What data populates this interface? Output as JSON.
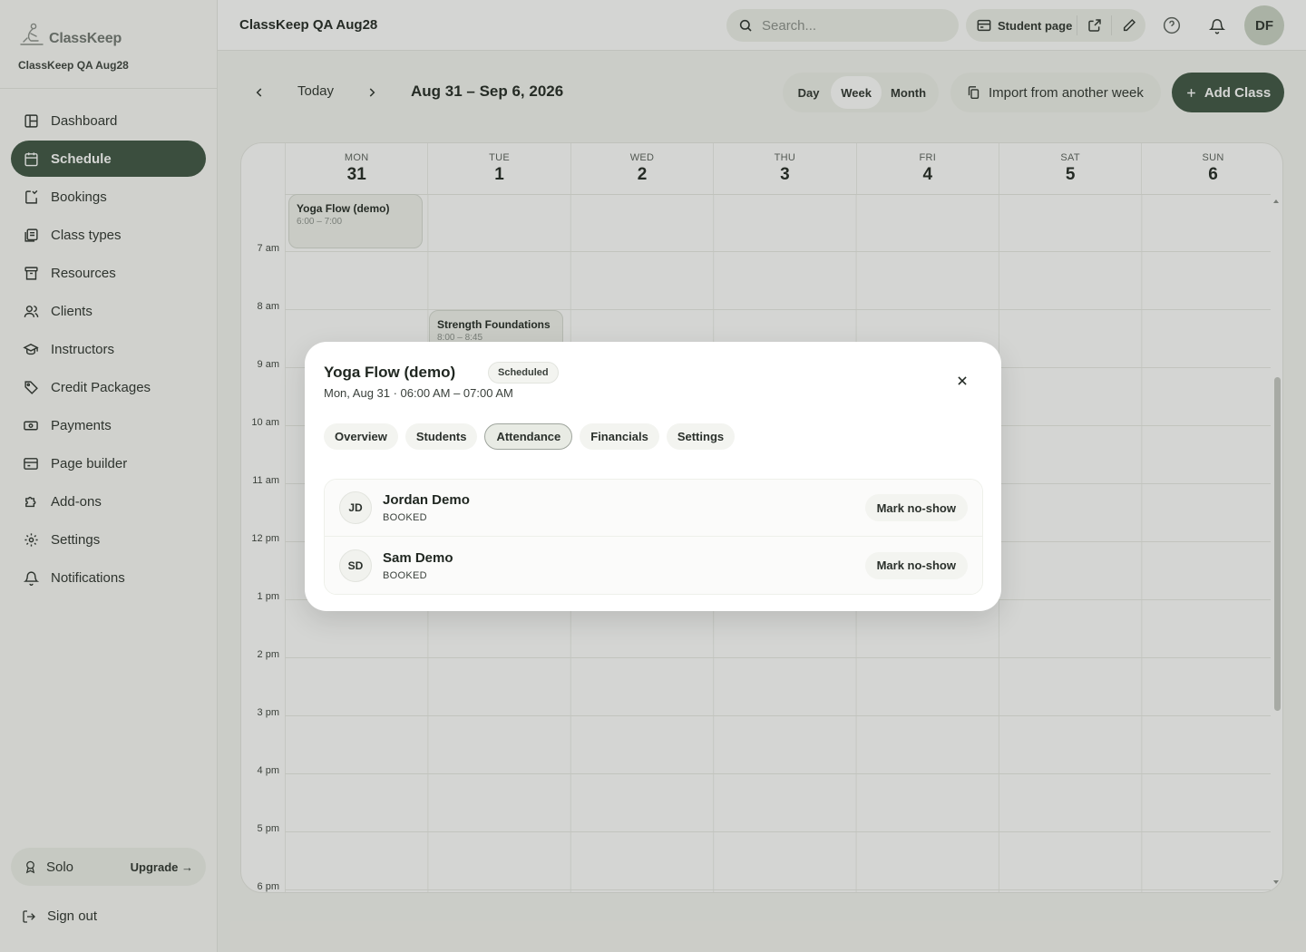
{
  "sidebar": {
    "brand": "ClassKeep",
    "studio": "ClassKeep QA Aug28",
    "items": [
      {
        "label": "Dashboard",
        "icon": "dashboard-icon"
      },
      {
        "label": "Schedule",
        "icon": "calendar-icon",
        "active": true
      },
      {
        "label": "Bookings",
        "icon": "bookings-icon"
      },
      {
        "label": "Class types",
        "icon": "class-types-icon"
      },
      {
        "label": "Resources",
        "icon": "archive-icon"
      },
      {
        "label": "Clients",
        "icon": "users-icon"
      },
      {
        "label": "Instructors",
        "icon": "graduation-cap-icon"
      },
      {
        "label": "Credit Packages",
        "icon": "tag-icon"
      },
      {
        "label": "Payments",
        "icon": "banknote-icon"
      },
      {
        "label": "Page builder",
        "icon": "layout-icon"
      },
      {
        "label": "Add-ons",
        "icon": "puzzle-icon"
      },
      {
        "label": "Settings",
        "icon": "gear-icon"
      },
      {
        "label": "Notifications",
        "icon": "bell-icon"
      }
    ],
    "plan": {
      "name": "Solo",
      "upgrade": "Upgrade →"
    },
    "signout": "Sign out"
  },
  "topbar": {
    "title": "ClassKeep QA Aug28",
    "search_placeholder": "Search...",
    "student_page": "Student page",
    "avatar": "DF"
  },
  "toolbar": {
    "today": "Today",
    "range": "Aug 31 – Sep 6, 2026",
    "views": [
      {
        "label": "Day"
      },
      {
        "label": "Week",
        "active": true
      },
      {
        "label": "Month"
      }
    ],
    "import": "Import from another week",
    "add": "Add Class"
  },
  "calendar": {
    "days": [
      {
        "name": "MON",
        "num": "31"
      },
      {
        "name": "TUE",
        "num": "1"
      },
      {
        "name": "WED",
        "num": "2"
      },
      {
        "name": "THU",
        "num": "3"
      },
      {
        "name": "FRI",
        "num": "4"
      },
      {
        "name": "SAT",
        "num": "5"
      },
      {
        "name": "SUN",
        "num": "6"
      }
    ],
    "hours": [
      "7 am",
      "8 am",
      "9 am",
      "10 am",
      "11 am",
      "12 pm",
      "1 pm",
      "2 pm",
      "3 pm",
      "4 pm",
      "5 pm",
      "6 pm"
    ],
    "events": [
      {
        "title": "Yoga Flow (demo)",
        "time": "6:00 – 7:00",
        "day": "MON"
      },
      {
        "title": "Strength Foundations",
        "time": "8:00 – 8:45",
        "day": "TUE"
      }
    ]
  },
  "modal": {
    "title": "Yoga Flow (demo)",
    "badge": "Scheduled",
    "subtitle": "Mon, Aug 31 · 06:00 AM – 07:00 AM",
    "tabs": [
      {
        "label": "Overview"
      },
      {
        "label": "Students"
      },
      {
        "label": "Attendance",
        "active": true
      },
      {
        "label": "Financials"
      },
      {
        "label": "Settings"
      }
    ],
    "attendees": [
      {
        "initials": "JD",
        "name": "Jordan Demo",
        "status": "BOOKED",
        "action": "Mark no-show"
      },
      {
        "initials": "SD",
        "name": "Sam Demo",
        "status": "BOOKED",
        "action": "Mark no-show"
      }
    ]
  }
}
